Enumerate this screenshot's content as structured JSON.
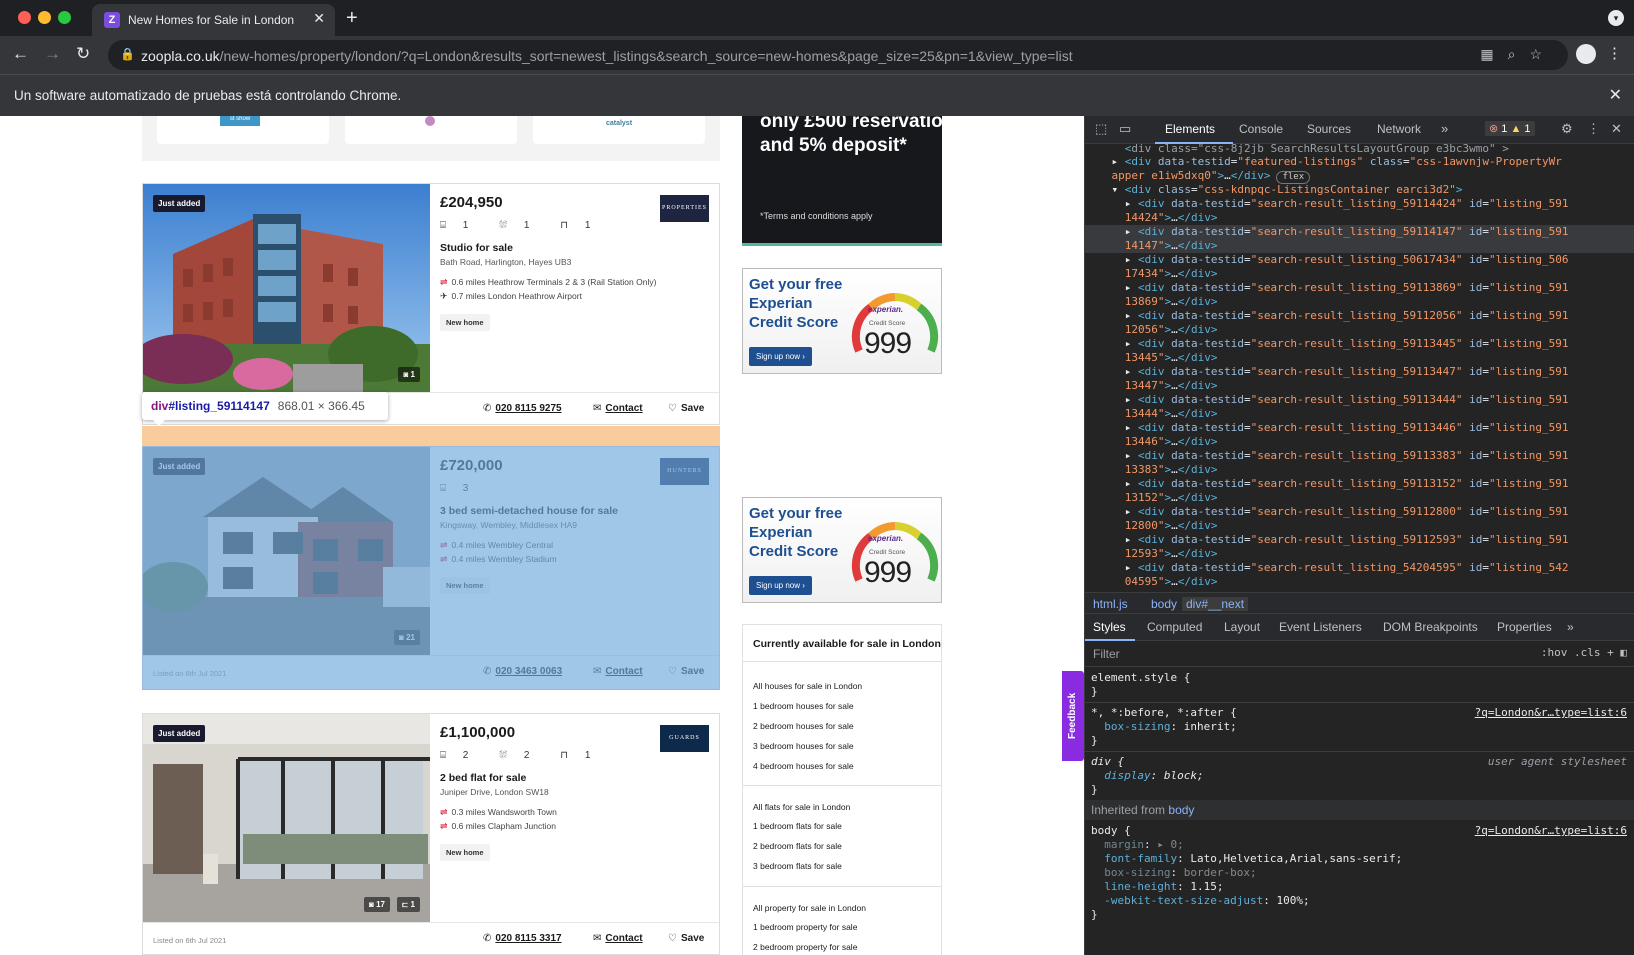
{
  "browser": {
    "tab_title": "New Homes for Sale in London",
    "url_domain": "zoopla.co.uk",
    "url_path": "/new-homes/property/london/?q=London&results_sort=newest_listings&search_source=new-homes&page_size=25&pn=1&view_type=list",
    "infobar_text": "Un software automatizado de pruebas está controlando Chrome.",
    "icons": {
      "back": "back-arrow-icon",
      "forward": "forward-arrow-icon",
      "reload": "reload-icon",
      "lock": "lock-icon",
      "close": "close-icon"
    }
  },
  "page": {
    "dev_logos": [
      "st show",
      "",
      "catalyst"
    ],
    "listings": [
      {
        "badge": "Just added",
        "price": "£204,950",
        "beds": "1",
        "baths": "1",
        "receptions": "1",
        "title": "Studio for sale",
        "address": "Bath Road, Harlington, Hayes UB3",
        "transit": [
          "0.6 miles Heathrow Terminals 2 & 3 (Rail Station Only)",
          "0.7 miles London Heathrow Airport"
        ],
        "tag": "New home",
        "photos": "1",
        "floorplans": "",
        "listed": "",
        "phone": "020 8115 9275",
        "contact": "Contact",
        "save": "Save",
        "agent": "PROPERTIES",
        "agent_color": "#1e2540"
      },
      {
        "badge": "Just added",
        "price": "£720,000",
        "beds": "3",
        "baths": "",
        "receptions": "",
        "title": "3 bed semi-detached house for sale",
        "address": "Kingsway, Wembley, Middlesex HA9",
        "transit": [
          "0.4 miles Wembley Central",
          "0.4 miles Wembley Stadium"
        ],
        "tag": "New home",
        "photos": "21",
        "floorplans": "",
        "listed": "Listed on 6th Jul 2021",
        "phone": "020 3463 0063",
        "contact": "Contact",
        "save": "Save",
        "agent": "HUNTERS",
        "agent_color": "#1a2e5a"
      },
      {
        "badge": "Just added",
        "price": "£1,100,000",
        "beds": "2",
        "baths": "2",
        "receptions": "1",
        "title": "2 bed flat for sale",
        "address": "Juniper Drive, London SW18",
        "transit": [
          "0.3 miles Wandsworth Town",
          "0.6 miles Clapham Junction"
        ],
        "tag": "New home",
        "photos": "17",
        "floorplans": "1",
        "listed": "Listed on 6th Jul 2021",
        "phone": "020 8115 3317",
        "contact": "Contact",
        "save": "Save",
        "agent": "GUARDS",
        "agent_color": "#0e2a4a"
      }
    ],
    "inspect_tooltip": {
      "tag": "div",
      "id": "#listing_59114147",
      "dims": "868.01 × 366.45"
    },
    "ads": {
      "reservation_line1": "only £500 reservatio",
      "reservation_line2": "and 5% deposit*",
      "reservation_terms": "*Terms and conditions apply",
      "experian_head": "Get your free Experian Credit Score",
      "experian_btn": "Sign up now ›",
      "experian_brand": "experian.",
      "experian_label": "Credit Score",
      "experian_score": "999"
    },
    "available": {
      "title": "Currently available for sale in London",
      "houses": [
        "All houses for sale in London",
        "1 bedroom houses for sale",
        "2 bedroom houses for sale",
        "3 bedroom houses for sale",
        "4 bedroom houses for sale"
      ],
      "flats": [
        "All flats for sale in London",
        "1 bedroom flats for sale",
        "2 bedroom flats for sale",
        "3 bedroom flats for sale"
      ],
      "property": [
        "All property for sale in London",
        "1 bedroom property for sale",
        "2 bedroom property for sale"
      ]
    },
    "feedback": "Feedback"
  },
  "devtools": {
    "tabs": [
      "Elements",
      "Console",
      "Sources",
      "Network"
    ],
    "errors": "1",
    "warnings": "1",
    "dom_top": {
      "class_fragment": "div class=\"css-8j2jb SearchResultsLayoutGroup e3bc3wmo\" >"
    },
    "featured": {
      "testid": "featured-listings",
      "class": "css-1awvnjw-PropertyWr apper e1iw5dxq0",
      "pill": "flex"
    },
    "container_class": "css-kdnpqc-ListingsContainer earci3d2",
    "listings": [
      {
        "testid": "search-result_listing_59114424",
        "id": "listing_591 14424"
      },
      {
        "testid": "search-result_listing_59114147",
        "id": "listing_591 14147"
      },
      {
        "testid": "search-result_listing_50617434",
        "id": "listing_506 17434"
      },
      {
        "testid": "search-result_listing_59113869",
        "id": "listing_591 13869"
      },
      {
        "testid": "search-result_listing_59112056",
        "id": "listing_591 12056"
      },
      {
        "testid": "search-result_listing_59113445",
        "id": "listing_591 13445"
      },
      {
        "testid": "search-result_listing_59113447",
        "id": "listing_591 13447"
      },
      {
        "testid": "search-result_listing_59113444",
        "id": "listing_591 13444"
      },
      {
        "testid": "search-result_listing_59113446",
        "id": "listing_591 13446"
      },
      {
        "testid": "search-result_listing_59113383",
        "id": "listing_591 13383"
      },
      {
        "testid": "search-result_listing_59113152",
        "id": "listing_591 13152"
      },
      {
        "testid": "search-result_listing_59112800",
        "id": "listing_591 12800"
      },
      {
        "testid": "search-result_listing_59112593",
        "id": "listing_591 12593"
      },
      {
        "testid": "search-result_listing_54204595",
        "id": "listing_542 04595"
      }
    ],
    "breadcrumbs": [
      "html.js",
      "body",
      "div#__next"
    ],
    "sub_tabs": [
      "Styles",
      "Computed",
      "Layout",
      "Event Listeners",
      "DOM Breakpoints",
      "Properties"
    ],
    "filter_placeholder": "Filter",
    "filter_tools": ":hov  .cls  +",
    "styles": {
      "element_style": "element.style {",
      "universal_selector": "*, *:before, *:after {",
      "universal_prop": "box-sizing",
      "universal_val": "inherit;",
      "source_link": "?q=London&r…type=list:6",
      "div_selector": "div {",
      "ua_label": "user agent stylesheet",
      "div_prop": "display",
      "div_val": "block;",
      "inherited_label": "Inherited from",
      "inherited_from": "body",
      "body_selector": "body {",
      "body_props": [
        {
          "name": "margin",
          "value": "▸ 0;",
          "faded": true
        },
        {
          "name": "font-family",
          "value": "Lato,Helvetica,Arial,sans-serif;",
          "faded": false
        },
        {
          "name": "box-sizing",
          "value": "border-box;",
          "faded": true
        },
        {
          "name": "line-height",
          "value": "1.15;",
          "faded": false
        },
        {
          "name": "-webkit-text-size-adjust",
          "value": "100%;",
          "faded": false
        }
      ]
    }
  }
}
